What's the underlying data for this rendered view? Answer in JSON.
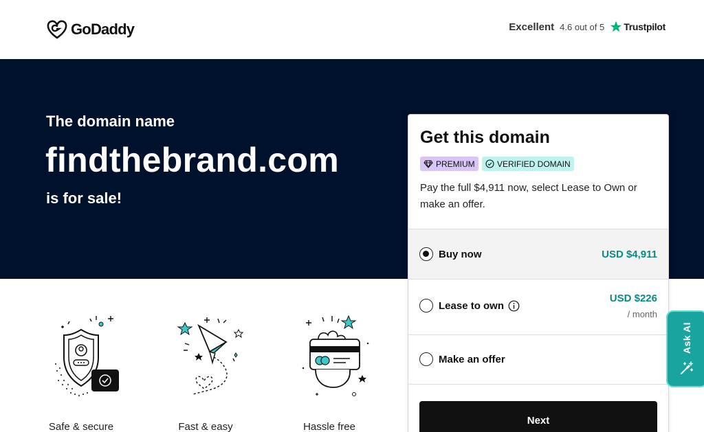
{
  "header": {
    "logo_text": "GoDaddy",
    "rating": {
      "label": "Excellent",
      "score_text": "4.6 out of 5",
      "provider": "Trustpilot"
    }
  },
  "hero": {
    "pre_text": "The domain name",
    "domain": "findthebrand.com",
    "post_text": "is for sale!"
  },
  "features": [
    {
      "label": "Safe & secure",
      "icon": "shield-icon"
    },
    {
      "label": "Fast & easy",
      "icon": "paper-plane-icon"
    },
    {
      "label": "Hassle free",
      "icon": "card-hand-icon"
    }
  ],
  "card": {
    "title": "Get this domain",
    "badges": [
      {
        "label": "PREMIUM",
        "icon": "diamond-icon"
      },
      {
        "label": "VERIFIED DOMAIN",
        "icon": "check-circle-icon"
      }
    ],
    "description": "Pay the full $4,911 now, select Lease to Own or make an offer.",
    "options": [
      {
        "label": "Buy now",
        "price": "USD $4,911",
        "sub": "",
        "selected": true
      },
      {
        "label": "Lease to own",
        "price": "USD $226",
        "sub": "/ month",
        "selected": false,
        "has_info": true
      },
      {
        "label": "Make an offer",
        "price": "",
        "sub": "",
        "selected": false
      }
    ],
    "next_label": "Next"
  },
  "ask_ai": {
    "label": "Ask AI"
  },
  "colors": {
    "hero_bg": "#00112c",
    "accent_teal": "#0a8a84",
    "premium_badge": "#d8c6f7",
    "verified_badge": "#bff3ef",
    "ask_ai_bg": "#1aa4a0",
    "trustpilot_star": "#00b67a"
  }
}
